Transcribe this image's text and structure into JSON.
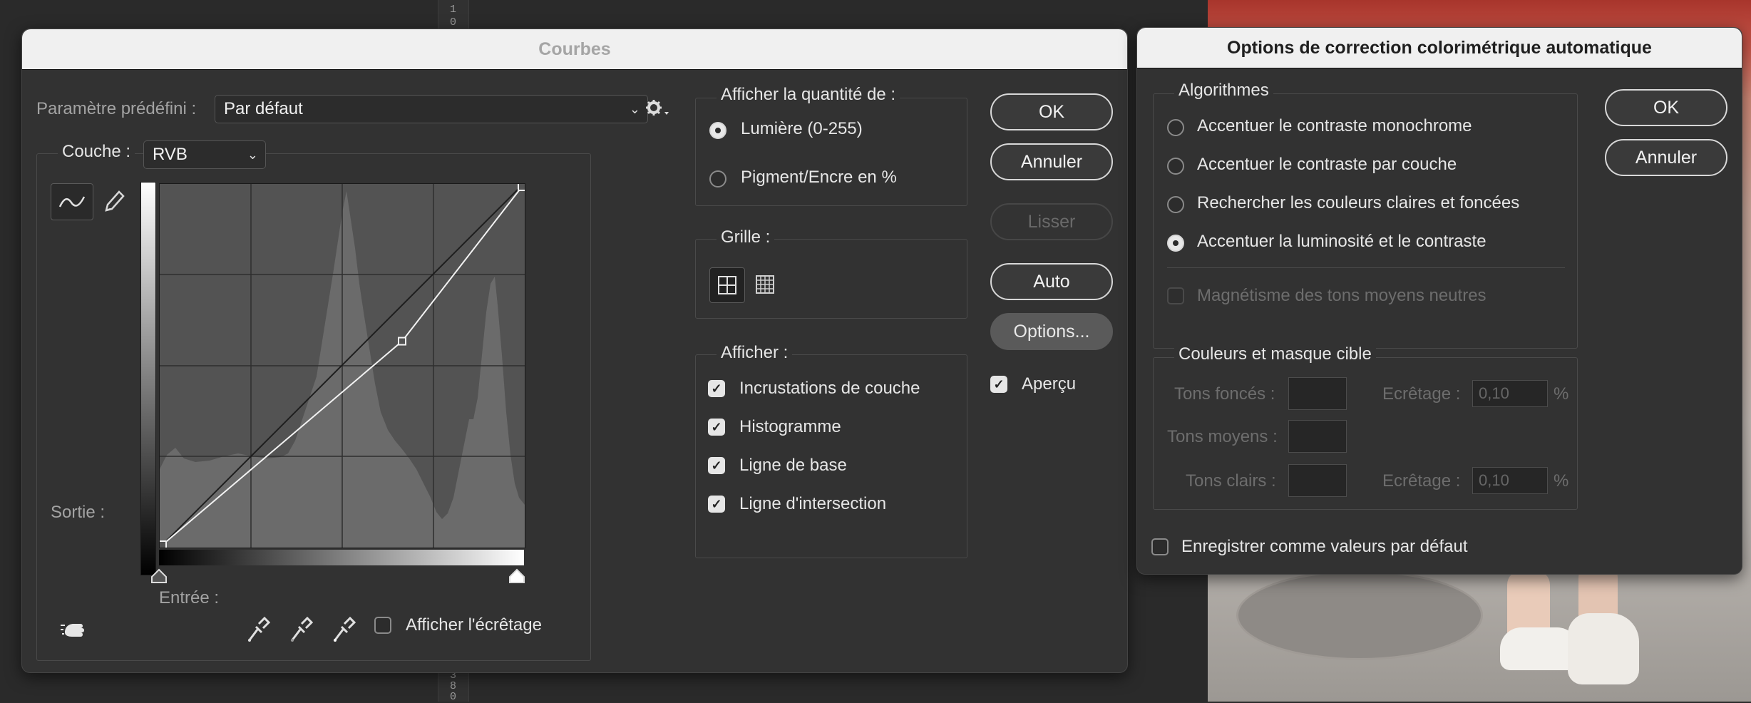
{
  "ruler": {
    "top_digits": [
      "1",
      "0"
    ],
    "bottom_digits": [
      "3",
      "8",
      "0"
    ]
  },
  "curves": {
    "title": "Courbes",
    "preset_label": "Paramètre prédéfini :",
    "preset_value": "Par défaut",
    "channel_label": "Couche :",
    "channel_value": "RVB",
    "output_label": "Sortie :",
    "input_label": "Entrée :",
    "show_clipping_label": "Afficher l'écrêtage",
    "show_amount": {
      "title": "Afficher la quantité de :",
      "options": [
        "Lumière (0-255)",
        "Pigment/Encre en %"
      ],
      "selected_index": 0
    },
    "grid": {
      "title": "Grille :"
    },
    "display": {
      "title": "Afficher :",
      "items": [
        {
          "label": "Incrustations de couche",
          "checked": true
        },
        {
          "label": "Histogramme",
          "checked": true
        },
        {
          "label": "Ligne de base",
          "checked": true
        },
        {
          "label": "Ligne d'intersection",
          "checked": true
        }
      ]
    },
    "buttons": {
      "ok": "OK",
      "cancel": "Annuler",
      "smooth": "Lisser",
      "auto": "Auto",
      "options": "Options..."
    },
    "preview": {
      "label": "Aperçu",
      "checked": true
    },
    "curve_points": [
      [
        0,
        0
      ],
      [
        170,
        145
      ],
      [
        255,
        255
      ]
    ]
  },
  "auto_options": {
    "title": "Options de correction colorimétrique automatique",
    "algorithms": {
      "title": "Algorithmes",
      "options": [
        "Accentuer le contraste monochrome",
        "Accentuer le contraste par couche",
        "Rechercher les couleurs claires et foncées",
        "Accentuer la luminosité et le contraste"
      ],
      "selected_index": 3,
      "snap_label": "Magnétisme des tons moyens neutres"
    },
    "target": {
      "title": "Couleurs et masque cible",
      "shadows_label": "Tons foncés :",
      "midtones_label": "Tons moyens :",
      "highlights_label": "Tons clairs :",
      "clip_label": "Ecrêtage :",
      "shadows_clip": "0,10",
      "highlights_clip": "0,10",
      "percent": "%"
    },
    "save_default_label": "Enregistrer comme valeurs par défaut",
    "buttons": {
      "ok": "OK",
      "cancel": "Annuler"
    }
  }
}
